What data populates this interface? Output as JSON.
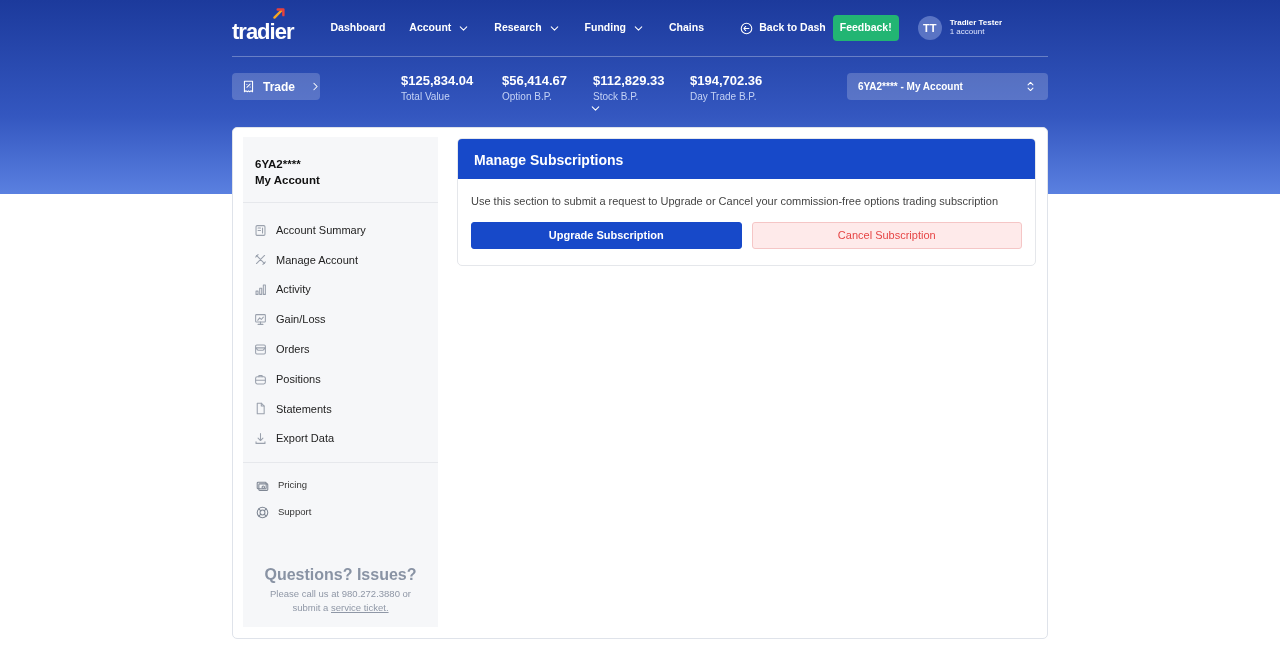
{
  "header": {
    "logo": "tradier",
    "nav": [
      {
        "label": "Dashboard",
        "dropdown": false
      },
      {
        "label": "Account",
        "dropdown": true
      },
      {
        "label": "Research",
        "dropdown": true
      },
      {
        "label": "Funding",
        "dropdown": true
      },
      {
        "label": "Chains",
        "dropdown": false
      }
    ],
    "back_link": "Back to Dash",
    "feedback_button": "Feedback!",
    "user": {
      "initials": "TT",
      "name": "Tradier Tester",
      "accounts": "1 account"
    }
  },
  "summary_bar": {
    "trade_button": "Trade",
    "stats": [
      {
        "value": "$125,834.04",
        "label": "Total Value"
      },
      {
        "value": "$56,414.67",
        "label": "Option B.P."
      },
      {
        "value": "$112,829.33",
        "label": "Stock B.P."
      },
      {
        "value": "$194,702.36",
        "label": "Day Trade B.P."
      }
    ],
    "account_select": "6YA2**** - My Account"
  },
  "sidebar": {
    "account_id": "6YA2****",
    "account_name": "My Account",
    "items": [
      {
        "label": "Account Summary"
      },
      {
        "label": "Manage Account"
      },
      {
        "label": "Activity"
      },
      {
        "label": "Gain/Loss"
      },
      {
        "label": "Orders"
      },
      {
        "label": "Positions"
      },
      {
        "label": "Statements"
      },
      {
        "label": "Export Data"
      }
    ],
    "secondary_items": [
      {
        "label": "Pricing"
      },
      {
        "label": "Support"
      }
    ],
    "help": {
      "title": "Questions? Issues?",
      "text": "Please call us at 980.272.3880 or submit a",
      "link": "service ticket."
    }
  },
  "panel": {
    "title": "Manage Subscriptions",
    "description": "Use this section to submit a request to Upgrade or Cancel your commission-free options trading subscription",
    "buttons": [
      {
        "label": "Upgrade Subscription",
        "kind": "primary"
      },
      {
        "label": "Cancel Subscription",
        "kind": "danger"
      }
    ]
  }
}
